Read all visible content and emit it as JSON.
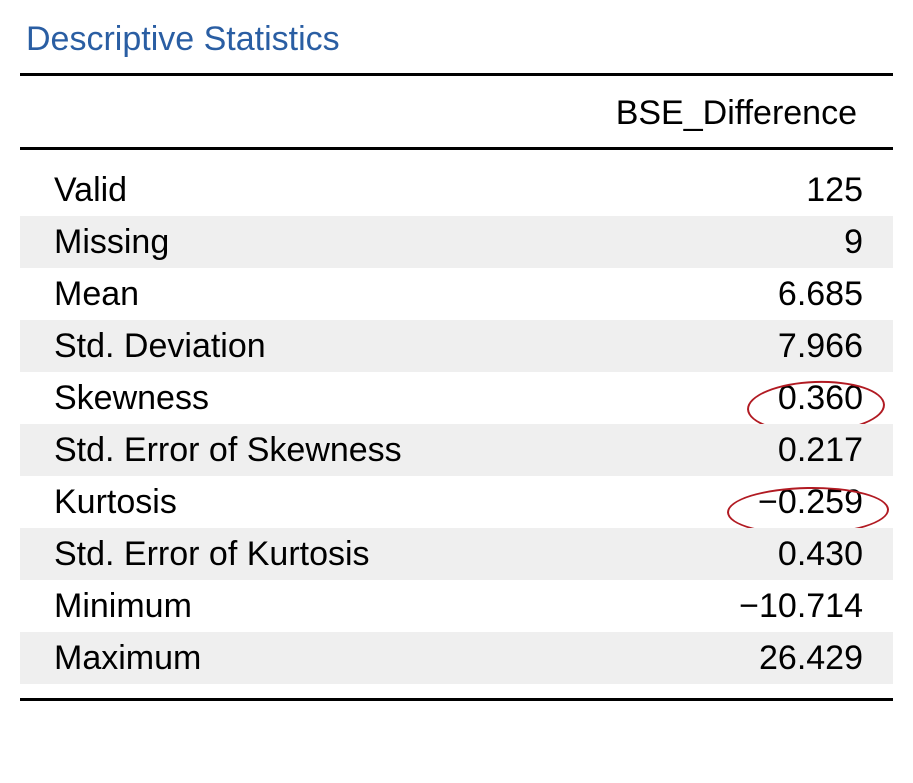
{
  "title": "Descriptive Statistics",
  "column_header": "BSE_Difference",
  "rows": {
    "valid": {
      "label": "Valid",
      "value": "125"
    },
    "missing": {
      "label": "Missing",
      "value": "9"
    },
    "mean": {
      "label": "Mean",
      "value": "6.685"
    },
    "std": {
      "label": "Std. Deviation",
      "value": "7.966"
    },
    "skew": {
      "label": "Skewness",
      "value": "0.360"
    },
    "seskew": {
      "label": "Std. Error of Skewness",
      "value": "0.217"
    },
    "kurt": {
      "label": "Kurtosis",
      "value": "−0.259"
    },
    "sekurt": {
      "label": "Std. Error of Kurtosis",
      "value": "0.430"
    },
    "min": {
      "label": "Minimum",
      "value": "−10.714"
    },
    "max": {
      "label": "Maximum",
      "value": "26.429"
    }
  },
  "chart_data": {
    "type": "table",
    "title": "Descriptive Statistics",
    "variable": "BSE_Difference",
    "statistics": {
      "Valid": 125,
      "Missing": 9,
      "Mean": 6.685,
      "Std. Deviation": 7.966,
      "Skewness": 0.36,
      "Std. Error of Skewness": 0.217,
      "Kurtosis": -0.259,
      "Std. Error of Kurtosis": 0.43,
      "Minimum": -10.714,
      "Maximum": 26.429
    },
    "highlighted": [
      "Skewness",
      "Kurtosis"
    ]
  }
}
